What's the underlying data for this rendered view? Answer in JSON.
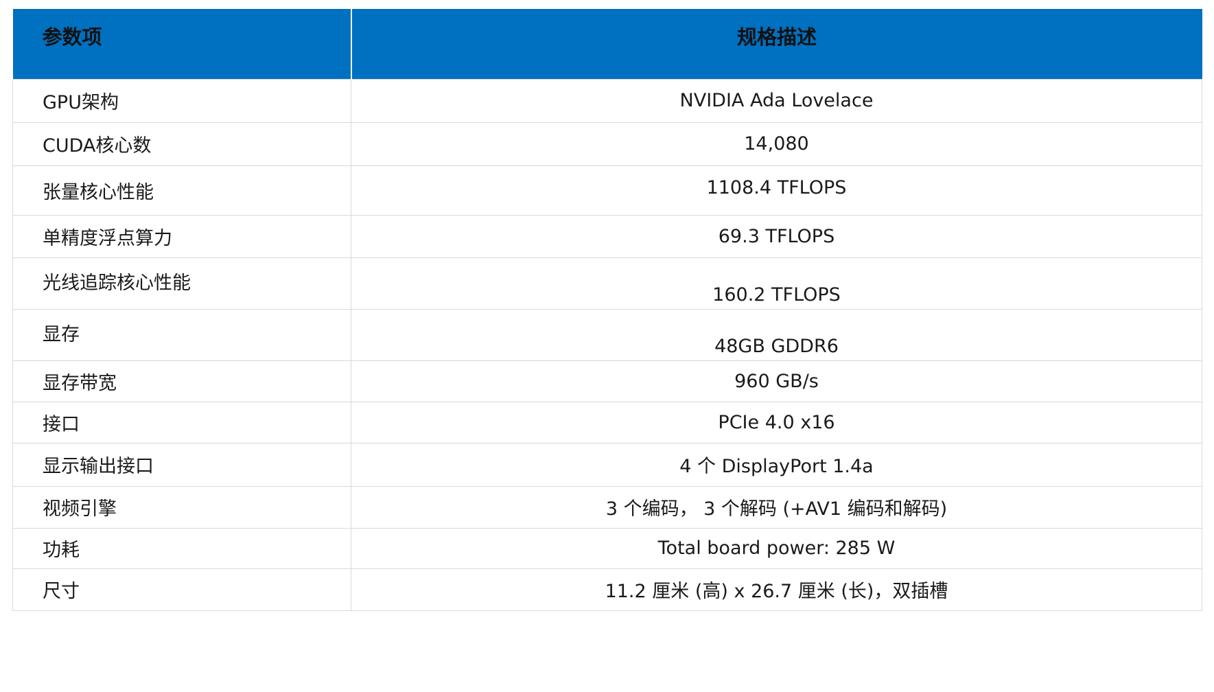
{
  "header": {
    "param": "参数项",
    "spec": "规格描述"
  },
  "rows": [
    {
      "param": "GPU架构",
      "value": "NVIDIA Ada Lovelace"
    },
    {
      "param": "CUDA核心数",
      "value": "14,080"
    },
    {
      "param": "张量核心性能",
      "value": "1108.4 TFLOPS"
    },
    {
      "param": "单精度浮点算力",
      "value": "69.3 TFLOPS"
    },
    {
      "param": "光线追踪核心性能",
      "value": "160.2 TFLOPS"
    },
    {
      "param": "显存",
      "value": "48GB GDDR6"
    },
    {
      "param": "显存带宽",
      "value": "960 GB/s"
    },
    {
      "param": "接口",
      "value": "PCIe 4.0 x16"
    },
    {
      "param": "显示输出接口",
      "value": "4 个 DisplayPort 1.4a"
    },
    {
      "param": "视频引擎",
      "value": "3 个编码， 3 个解码 (+AV1 编码和解码)"
    },
    {
      "param": "功耗",
      "value": "Total board power: 285 W"
    },
    {
      "param": "尺寸",
      "value": "11.2 厘米 (高) x 26.7 厘米 (长)，双插槽"
    }
  ]
}
